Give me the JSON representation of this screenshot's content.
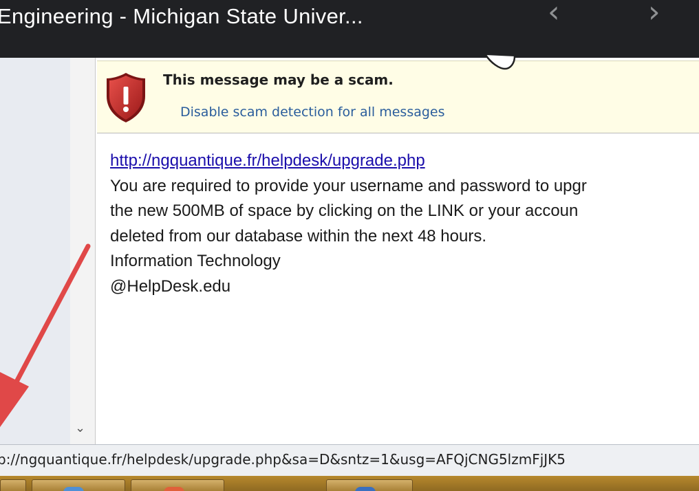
{
  "viewer": {
    "title": "Engineering - Michigan State Univer...",
    "prev_icon": "chevron-left-icon",
    "next_icon": "chevron-right-icon"
  },
  "scam_banner": {
    "title": "This message may be a scam.",
    "disable_link": "Disable scam detection for all messages",
    "icon": "shield-warning-icon",
    "background": "#fffde6"
  },
  "message": {
    "link": "http://ngquantique.fr/helpdesk/upgrade.php",
    "lines": [
      "You are required to provide your username and password to upgr",
      "the new 500MB of space by clicking on the LINK or your accoun",
      "deleted from our database within the next 48 hours.",
      "Information Technology",
      "@HelpDesk.edu"
    ]
  },
  "status_bar": {
    "url": "p://ngquantique.fr/helpdesk/upgrade.php&sa=D&sntz=1&usg=AFQjCNG5lzmFjJK5"
  },
  "annotation": {
    "arrow_color": "#e04848"
  },
  "colors": {
    "link": "#1a0dab",
    "banner_link": "#2a5d9c",
    "shield": "#c0282a"
  }
}
